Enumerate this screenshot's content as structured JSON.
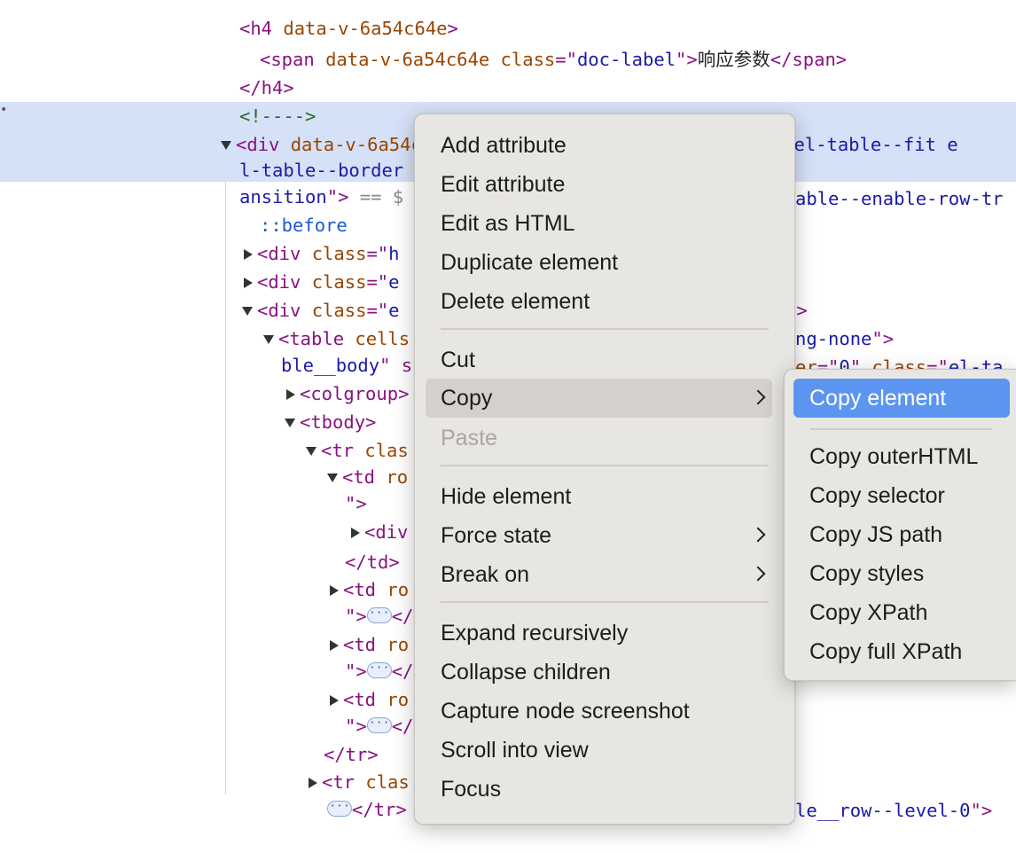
{
  "dom": {
    "line1": {
      "open": "<h4 ",
      "attr": "data-v-6a54c64e",
      "close": ">"
    },
    "line2": {
      "open": "<span ",
      "attr1": "data-v-6a54c64e",
      "attr2": "class",
      "eq": "=\"",
      "val": "doc-label",
      "q": "\">",
      "text": "响应参数",
      "end": "</span>"
    },
    "line3": "</h4>",
    "line4": "<!---->",
    "line5": {
      "open": "<div ",
      "attr1": "data-v-6a54c64e",
      "attr2": "class",
      "eq": "=\"",
      "val": "el-table el-table-tree el-table--fit e"
    },
    "line6": {
      "val1": "l-table--border",
      "val2": "able--enable-row-tr"
    },
    "line7": {
      "val": "ansition",
      "q": "\">",
      "eqs": " == $"
    },
    "line8": "::before",
    "line9": {
      "open": "<div ",
      "attr": "class",
      "eq": "=\"",
      "val": "h"
    },
    "line10": {
      "open": "<div ",
      "attr": "class",
      "eq": "=\"",
      "val": "e",
      "tail": "v>"
    },
    "line11": {
      "open": "<div ",
      "attr": "class",
      "eq": "=\"",
      "val": "e",
      "tail_val": "ng-none",
      "tail": "\">"
    },
    "line12": {
      "open": "<table ",
      "attr": "cells",
      "r_attr": "er",
      "r_eq": "=\"",
      "r_val": "0",
      "r_q": "\" ",
      "r_attr2": "class",
      "r_eq2": "=\"",
      "r_val2": "el-ta"
    },
    "line13": {
      "val": "ble__body",
      "q": "\" s"
    },
    "line14": "<colgroup>",
    "line15": "<tbody>",
    "line16": {
      "open": "<tr ",
      "attr": "clas"
    },
    "line17": {
      "open": "<td ",
      "attr": "ro"
    },
    "line18": "\">",
    "line19": "<div",
    "line20": "</td>",
    "line21": {
      "open": "<td ",
      "attr": "ro"
    },
    "line22": {
      "q": "\">",
      "ell": "···",
      "end": "</"
    },
    "line23": {
      "open": "<td ",
      "attr": "ro"
    },
    "line24": {
      "q": "\">",
      "ell": "···",
      "end": "</"
    },
    "line25": {
      "open": "<td ",
      "attr": "ro"
    },
    "line26": {
      "q": "\">",
      "ell": "···",
      "end": "</"
    },
    "line27": "</tr>",
    "line28": {
      "open": "<tr ",
      "attr": "clas",
      "r_val": "le__row--level-0",
      "r_q": "\">"
    },
    "line29": {
      "ell": "···",
      "end": "</tr>"
    }
  },
  "context_menu": {
    "items": [
      {
        "label": "Add attribute"
      },
      {
        "label": "Edit attribute"
      },
      {
        "label": "Edit as HTML"
      },
      {
        "label": "Duplicate element"
      },
      {
        "label": "Delete element"
      },
      {
        "label": "Cut"
      },
      {
        "label": "Copy"
      },
      {
        "label": "Paste"
      },
      {
        "label": "Hide element"
      },
      {
        "label": "Force state"
      },
      {
        "label": "Break on"
      },
      {
        "label": "Expand recursively"
      },
      {
        "label": "Collapse children"
      },
      {
        "label": "Capture node screenshot"
      },
      {
        "label": "Scroll into view"
      },
      {
        "label": "Focus"
      }
    ]
  },
  "copy_submenu": {
    "items": [
      {
        "label": "Copy element"
      },
      {
        "label": "Copy outerHTML"
      },
      {
        "label": "Copy selector"
      },
      {
        "label": "Copy JS path"
      },
      {
        "label": "Copy styles"
      },
      {
        "label": "Copy XPath"
      },
      {
        "label": "Copy full XPath"
      }
    ]
  },
  "colors": {
    "selection_bg": "#d5e1f7",
    "menu_bg": "#e8e6e3",
    "highlight": "#5c95f0",
    "tag": "#881280",
    "attribute": "#994500",
    "value": "#1a1aa6"
  }
}
